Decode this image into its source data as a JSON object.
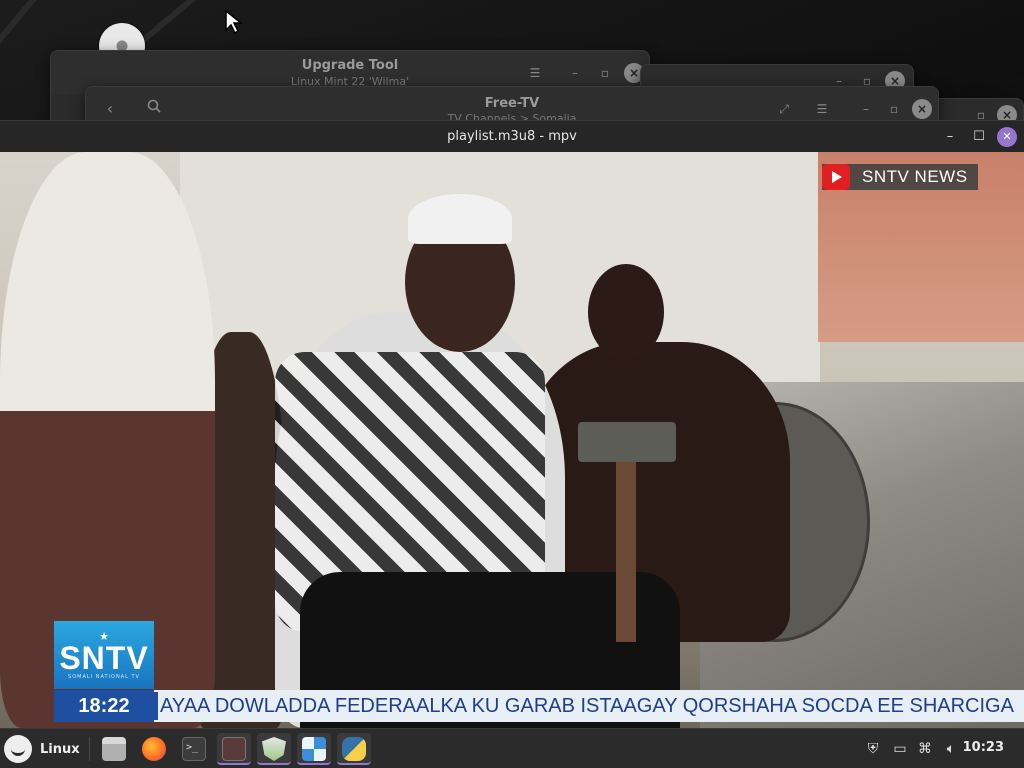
{
  "windows": {
    "upgrade_tool": {
      "title": "Upgrade Tool",
      "subtitle": "Linux Mint 22 'Wilma'"
    },
    "free_tv": {
      "title": "Free-TV",
      "subtitle": "TV Channels > Somalia"
    },
    "mpv": {
      "title": "playlist.m3u8 - mpv"
    }
  },
  "video": {
    "channel_badge": "SNTV NEWS",
    "logo_text": "SNTV",
    "logo_subtext": "SOMALI NATIONAL TV",
    "ticker_time": "18:22",
    "ticker_text": "AYAA DOWLADDA FEDERAALKA KU GARAB ISTAAGAY QORSHAHA SOCDA EE SHARCIGA"
  },
  "taskbar": {
    "menu_label": "Linux",
    "launchers": [
      "files",
      "firefox",
      "terminal",
      "mintupdate-dark",
      "mintupdate",
      "free-tv",
      "python"
    ],
    "clock": "10:23"
  },
  "colors": {
    "accent": "#9575cd",
    "ticker_blue": "#1f4fa0"
  }
}
